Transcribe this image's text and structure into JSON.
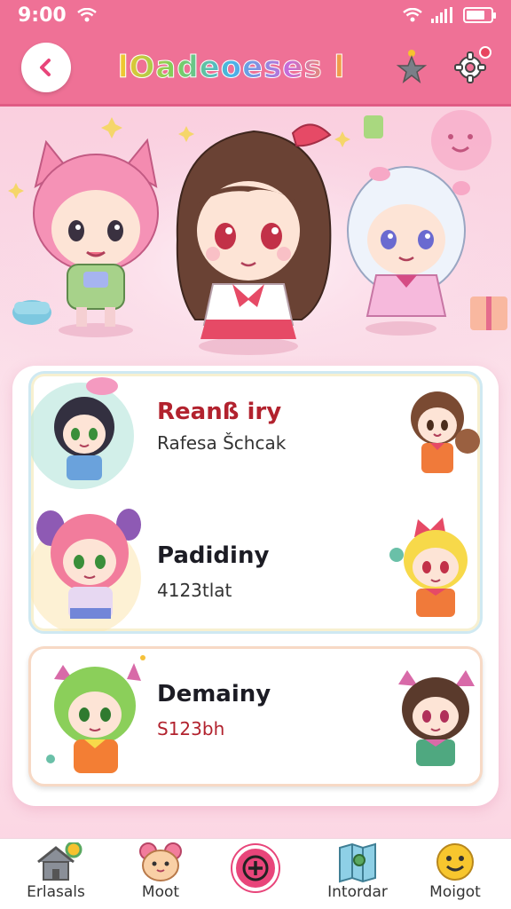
{
  "status_bar": {
    "time": "9:00",
    "battery_level": 0.75
  },
  "header": {
    "title": "lOadeoeses l",
    "back_icon": "back-arrow-icon",
    "icons": [
      "star-icon",
      "gear-icon"
    ]
  },
  "list": [
    {
      "name": "Reanß iry",
      "meta": "Rafesa Šchcak",
      "name_color": "#b2222e"
    },
    {
      "name": "Padidiny",
      "meta": "4123tlat",
      "name_color": "#1c1c24"
    },
    {
      "name": "Demainy",
      "meta": "S123bh",
      "name_color": "#1c1c24",
      "meta_color": "#b2222e"
    }
  ],
  "bottom_nav": [
    {
      "label": "Erlasals",
      "icon": "home-icon"
    },
    {
      "label": "Moot",
      "icon": "bear-face-icon"
    },
    {
      "label": "Intordar",
      "icon": "map-icon"
    },
    {
      "label": "Moigot",
      "icon": "smiley-icon"
    }
  ],
  "fab_icon": "plus-icon",
  "colors": {
    "primary": "#ef7196",
    "accent": "#e8457a",
    "background": "#fbdde8"
  }
}
